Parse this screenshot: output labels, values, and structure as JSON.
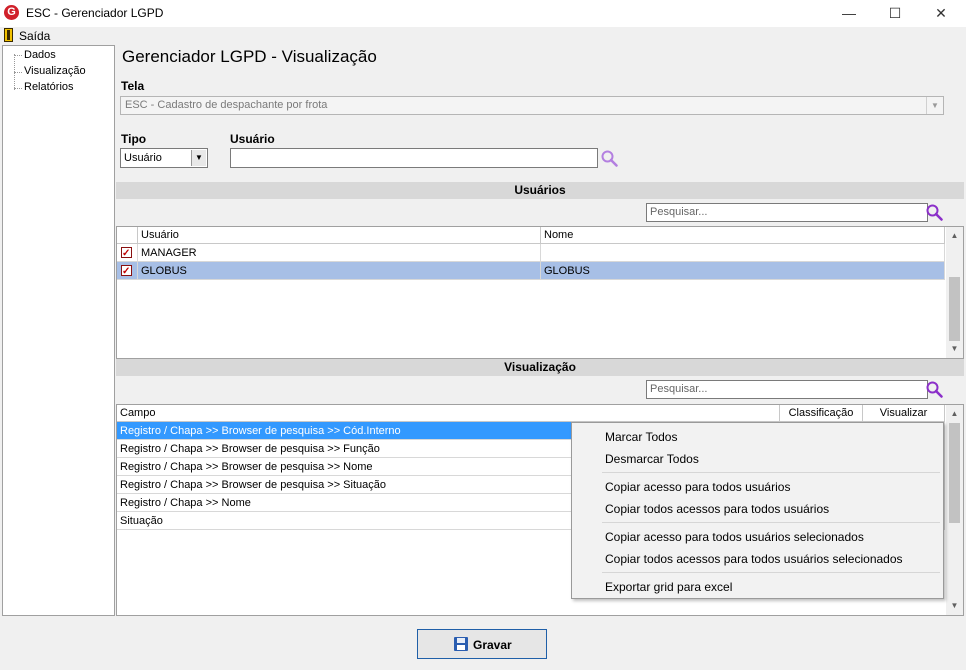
{
  "window": {
    "title": "ESC - Gerenciador LGPD",
    "logo_letter": "G",
    "minimize": "—",
    "maximize": "☐",
    "close": "✕"
  },
  "menu": {
    "exit": "Saída"
  },
  "tree": [
    "Dados",
    "Visualização",
    "Relatórios"
  ],
  "page_title": "Gerenciador LGPD - Visualização",
  "tela": {
    "label": "Tela",
    "value": "ESC - Cadastro de despachante por frota"
  },
  "tipo": {
    "label": "Tipo",
    "value": "Usuário"
  },
  "usuario": {
    "label": "Usuário",
    "value": ""
  },
  "users_section": {
    "title": "Usuários",
    "search_placeholder": "Pesquisar...",
    "columns": [
      "Usuário",
      "Nome"
    ],
    "rows": [
      {
        "checked": true,
        "usuario": "MANAGER",
        "nome": ""
      },
      {
        "checked": true,
        "usuario": "GLOBUS",
        "nome": "GLOBUS"
      }
    ]
  },
  "view_section": {
    "title": "Visualização",
    "search_placeholder": "Pesquisar...",
    "columns": [
      "Campo",
      "Classificação",
      "Visualizar"
    ],
    "rows": [
      "Registro / Chapa >> Browser de pesquisa >> Cód.Interno",
      "Registro / Chapa >> Browser de pesquisa >> Função",
      "Registro / Chapa >> Browser de pesquisa >> Nome",
      "Registro / Chapa >> Browser de pesquisa >> Situação",
      "Registro / Chapa >> Nome",
      "Situação"
    ]
  },
  "context_menu": [
    "Marcar Todos",
    "Desmarcar Todos",
    "Copiar acesso para todos usuários",
    "Copiar todos acessos para todos usuários",
    "Copiar acesso para todos usuários selecionados",
    "Copiar todos acessos para todos usuários selecionados",
    "Exportar grid para excel"
  ],
  "save_button": {
    "label": "Gravar"
  },
  "colors": {
    "selection_blue": "#3399ff",
    "row_selected": "#a7bfe6",
    "header_gray": "#d8d8d8",
    "search_icon": "#8b2fc9"
  },
  "icons": [
    "search-icon",
    "disk-icon",
    "exit-icon",
    "checkbox-checked-icon"
  ]
}
